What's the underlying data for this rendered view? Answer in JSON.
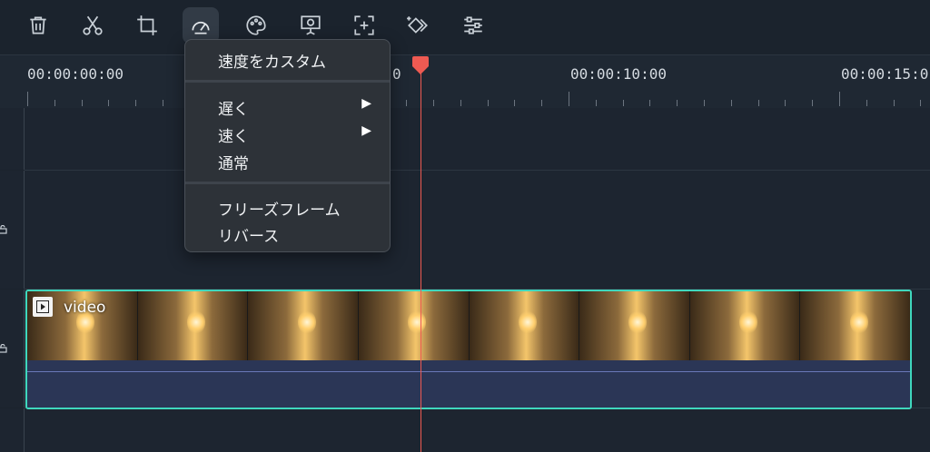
{
  "toolbar": {
    "tools": [
      {
        "name": "delete",
        "icon": "trash-icon"
      },
      {
        "name": "split",
        "icon": "scissors-icon"
      },
      {
        "name": "crop",
        "icon": "crop-icon"
      },
      {
        "name": "speed",
        "icon": "speedometer-icon",
        "active": true
      },
      {
        "name": "color",
        "icon": "palette-icon"
      },
      {
        "name": "presentation",
        "icon": "presentation-icon"
      },
      {
        "name": "add-keyframe",
        "icon": "frame-plus-icon"
      },
      {
        "name": "keyframe",
        "icon": "keyframe-diamond-icon"
      },
      {
        "name": "adjust",
        "icon": "sliders-icon"
      }
    ]
  },
  "ruler": {
    "timecodes": [
      "00:00:00:00",
      "0",
      "00:00:10:00",
      "00:00:15:0"
    ]
  },
  "speed_menu": {
    "custom_speed": "速度をカスタム",
    "slow": "遅く",
    "fast": "速く",
    "normal": "通常",
    "freeze_frame": "フリーズフレーム",
    "reverse": "リバース",
    "submenu_arrow": "▶"
  },
  "clip": {
    "label": "video",
    "border_color": "#3fd7bd"
  },
  "colors": {
    "background": "#1b232d",
    "playhead": "#ee5a52",
    "menu_bg": "#2d3238"
  }
}
